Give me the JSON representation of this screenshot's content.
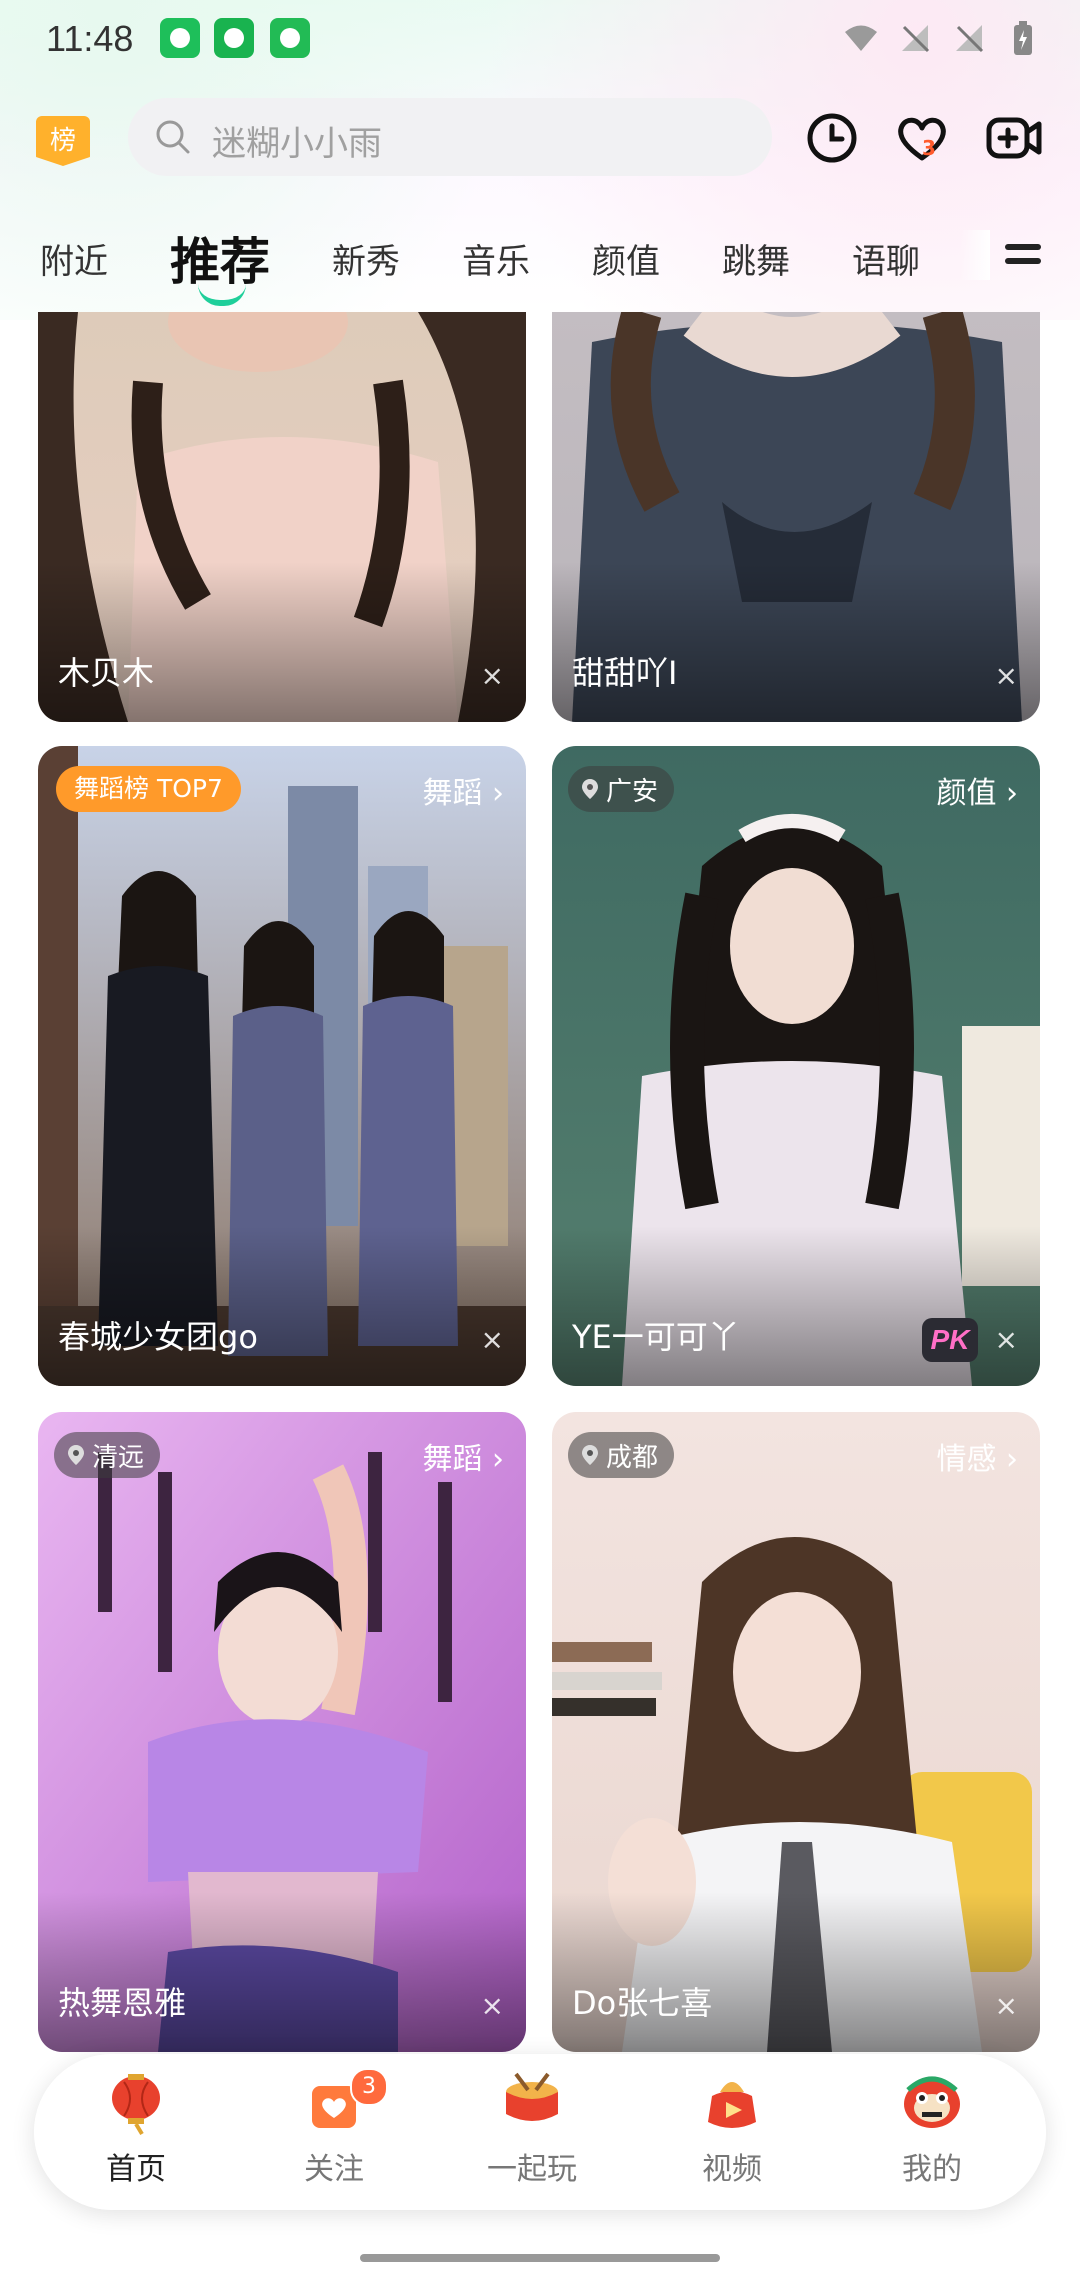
{
  "status_bar": {
    "time": "11:48"
  },
  "header": {
    "rank_badge": "榜",
    "search": {
      "placeholder": "迷糊小小雨"
    },
    "icons": [
      "clock-icon",
      "heart-icon",
      "live-camera-icon"
    ],
    "follow_count": "3"
  },
  "tabs": [
    "附近",
    "推荐",
    "新秀",
    "音乐",
    "颜值",
    "跳舞",
    "语聊"
  ],
  "active_tab": "推荐",
  "cards": [
    {
      "name": "木贝木"
    },
    {
      "name": "甜甜吖I"
    },
    {
      "name": "春城少女团go",
      "rank_tag": "舞蹈榜 TOP7",
      "category": "舞蹈"
    },
    {
      "name": "YE一可可丫",
      "location": "广安",
      "category": "颜值",
      "badge": "PK"
    },
    {
      "name": "热舞恩雅",
      "location": "清远",
      "category": "舞蹈"
    },
    {
      "name": "Do张七喜",
      "location": "成都",
      "category": "情感"
    }
  ],
  "close_symbol": "×",
  "chevron": "›",
  "bottom_nav": {
    "items": [
      {
        "label": "首页",
        "icon": "lantern-icon"
      },
      {
        "label": "关注",
        "icon": "follow-bag-icon",
        "badge": "3"
      },
      {
        "label": "一起玩",
        "icon": "drum-icon"
      },
      {
        "label": "视频",
        "icon": "video-pouch-icon"
      },
      {
        "label": "我的",
        "icon": "lion-mask-icon"
      }
    ]
  },
  "colors": {
    "accent": "#1fcf9a",
    "rank_tag": "#ff9a2a",
    "badge": "#ff6a3d"
  }
}
